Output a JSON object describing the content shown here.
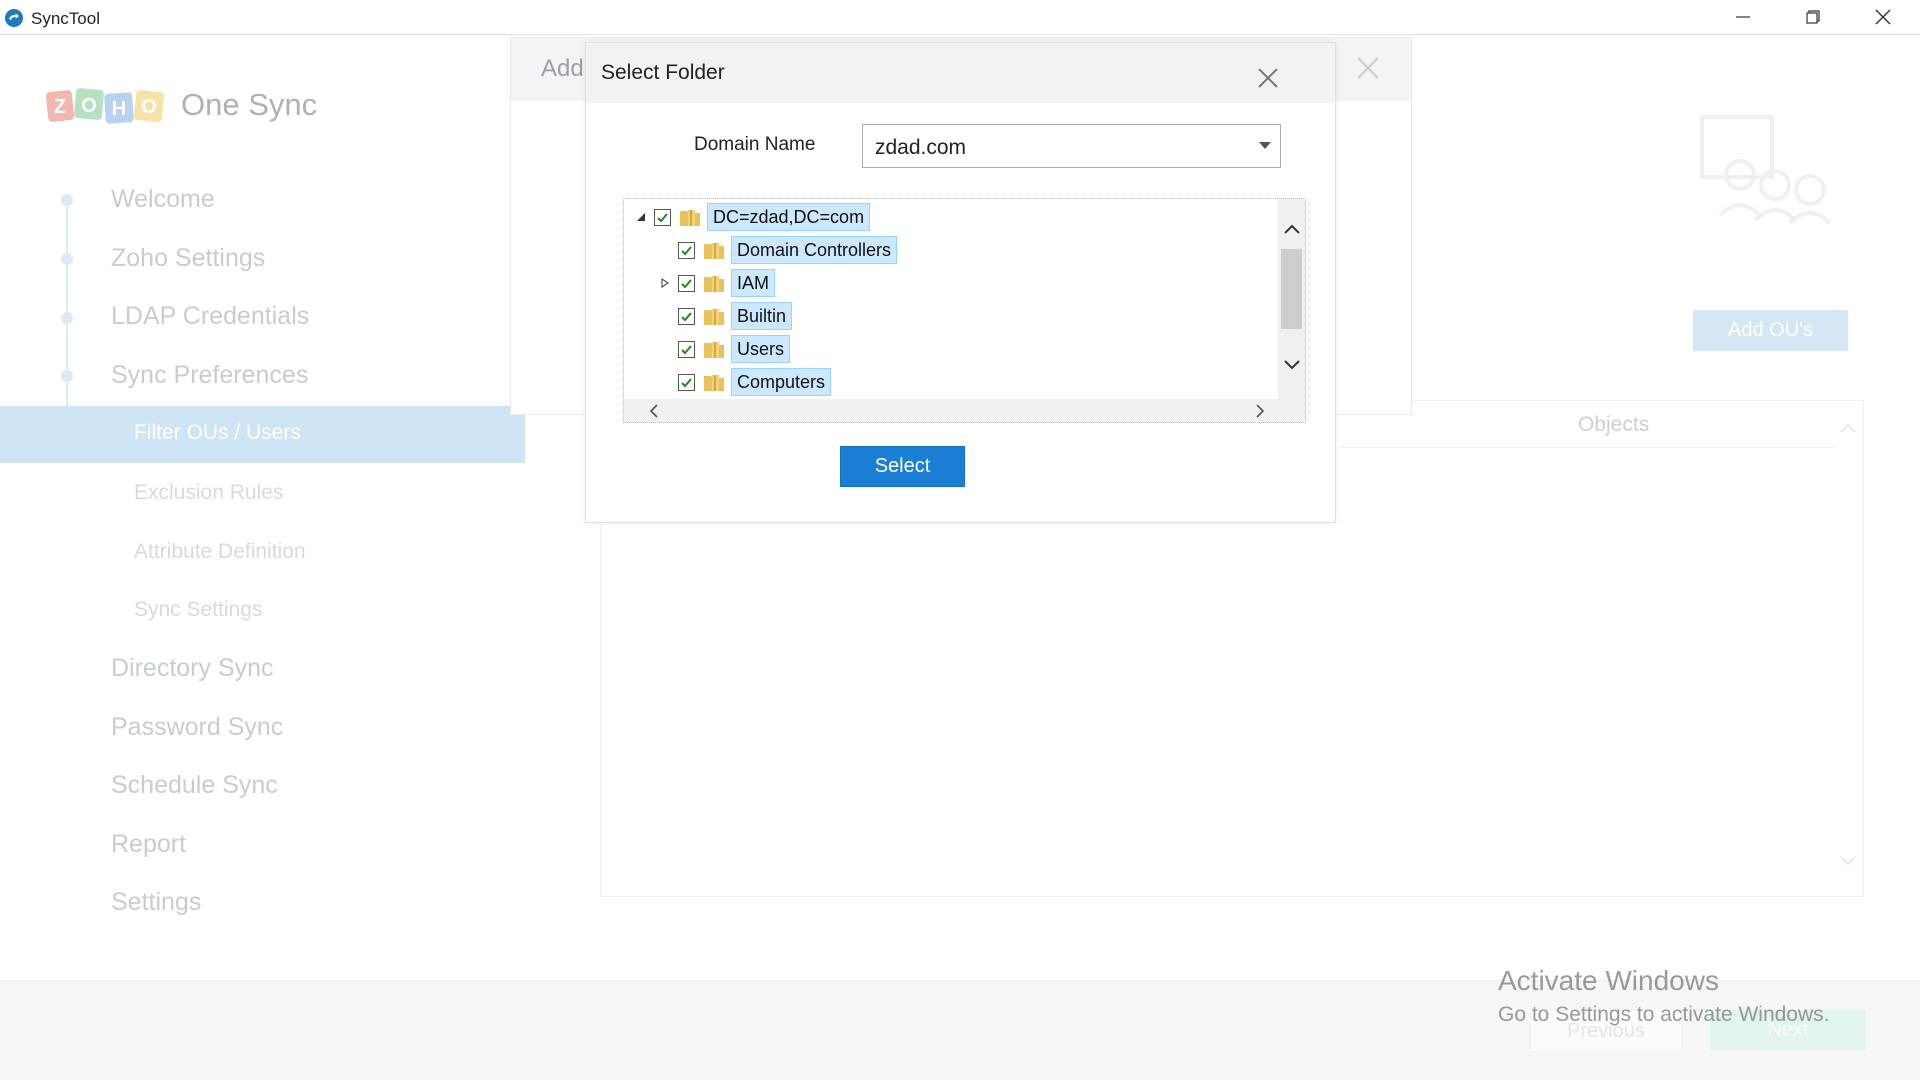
{
  "window": {
    "title": "SyncTool",
    "controls": [
      "minimize-icon",
      "restore-icon",
      "close-icon"
    ]
  },
  "sidebar": {
    "product": "One Sync",
    "logo_letters": [
      "Z",
      "O",
      "H",
      "O"
    ],
    "steps": [
      {
        "label": "Welcome"
      },
      {
        "label": "Zoho Settings"
      },
      {
        "label": "LDAP Credentials"
      },
      {
        "label": "Sync Preferences"
      }
    ],
    "sub_steps": [
      {
        "label": "Filter OUs / Users",
        "active": true
      },
      {
        "label": "Exclusion Rules"
      },
      {
        "label": "Attribute Definition"
      },
      {
        "label": "Sync Settings"
      }
    ],
    "more_steps": [
      {
        "label": "Directory Sync"
      },
      {
        "label": "Password Sync"
      },
      {
        "label": "Schedule Sync"
      },
      {
        "label": "Report"
      },
      {
        "label": "Settings"
      }
    ]
  },
  "main": {
    "add_ous_button": "Add OU's",
    "objects_header": "Objects"
  },
  "footer": {
    "previous": "Previous",
    "next": "Next"
  },
  "background_dialog": {
    "title": "Add"
  },
  "dialog": {
    "title": "Select Folder",
    "domain_label": "Domain Name",
    "domain_value": "zdad.com",
    "tree": [
      {
        "label": "DC=zdad,DC=com",
        "level": 0,
        "expander": "expanded",
        "checked": true
      },
      {
        "label": "Domain Controllers",
        "level": 1,
        "expander": "none",
        "checked": true
      },
      {
        "label": "IAM",
        "level": 1,
        "expander": "collapsed",
        "checked": true
      },
      {
        "label": "Builtin",
        "level": 1,
        "expander": "none",
        "checked": true
      },
      {
        "label": "Users",
        "level": 1,
        "expander": "none",
        "checked": true
      },
      {
        "label": "Computers",
        "level": 1,
        "expander": "none",
        "checked": true
      }
    ],
    "select_button": "Select"
  },
  "watermark": {
    "title": "Activate Windows",
    "subtitle": "Go to Settings to activate Windows."
  },
  "colors": {
    "accent": "#1a7fd4",
    "active_nav": "#cfe5f5",
    "checkbox_check": "#1e8a1e"
  }
}
